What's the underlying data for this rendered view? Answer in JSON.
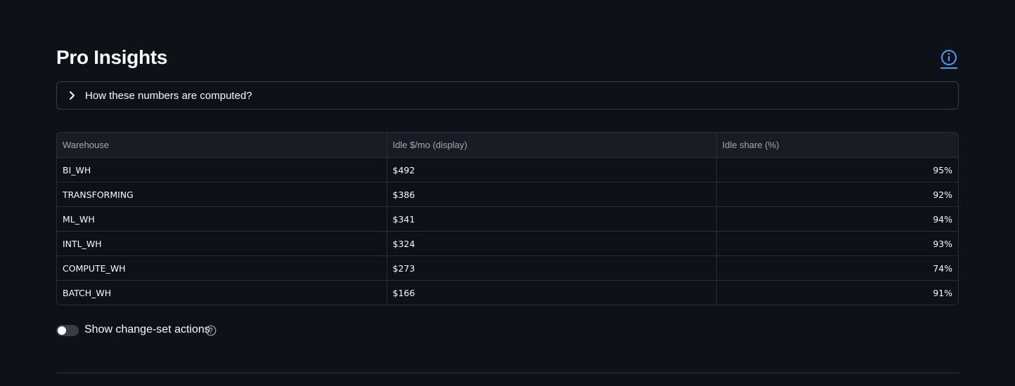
{
  "header": {
    "title": "Pro Insights",
    "info_icon": "info-circle-icon",
    "accent_color": "#4a9eff"
  },
  "expander": {
    "label": "How these numbers are computed?",
    "icon": "chevron-right-icon",
    "expanded": false
  },
  "table": {
    "columns": [
      "Warehouse",
      "Idle $/mo (display)",
      "Idle share (%)"
    ],
    "rows": [
      {
        "warehouse": "BI_WH",
        "idle_cost": "$492",
        "idle_share": "95%"
      },
      {
        "warehouse": "TRANSFORMING",
        "idle_cost": "$386",
        "idle_share": "92%"
      },
      {
        "warehouse": "ML_WH",
        "idle_cost": "$341",
        "idle_share": "94%"
      },
      {
        "warehouse": "INTL_WH",
        "idle_cost": "$324",
        "idle_share": "93%"
      },
      {
        "warehouse": "COMPUTE_WH",
        "idle_cost": "$273",
        "idle_share": "74%"
      },
      {
        "warehouse": "BATCH_WH",
        "idle_cost": "$166",
        "idle_share": "91%"
      }
    ]
  },
  "toggle": {
    "label": "Show change-set actions",
    "checked": false,
    "help_icon": "question-circle-icon"
  }
}
